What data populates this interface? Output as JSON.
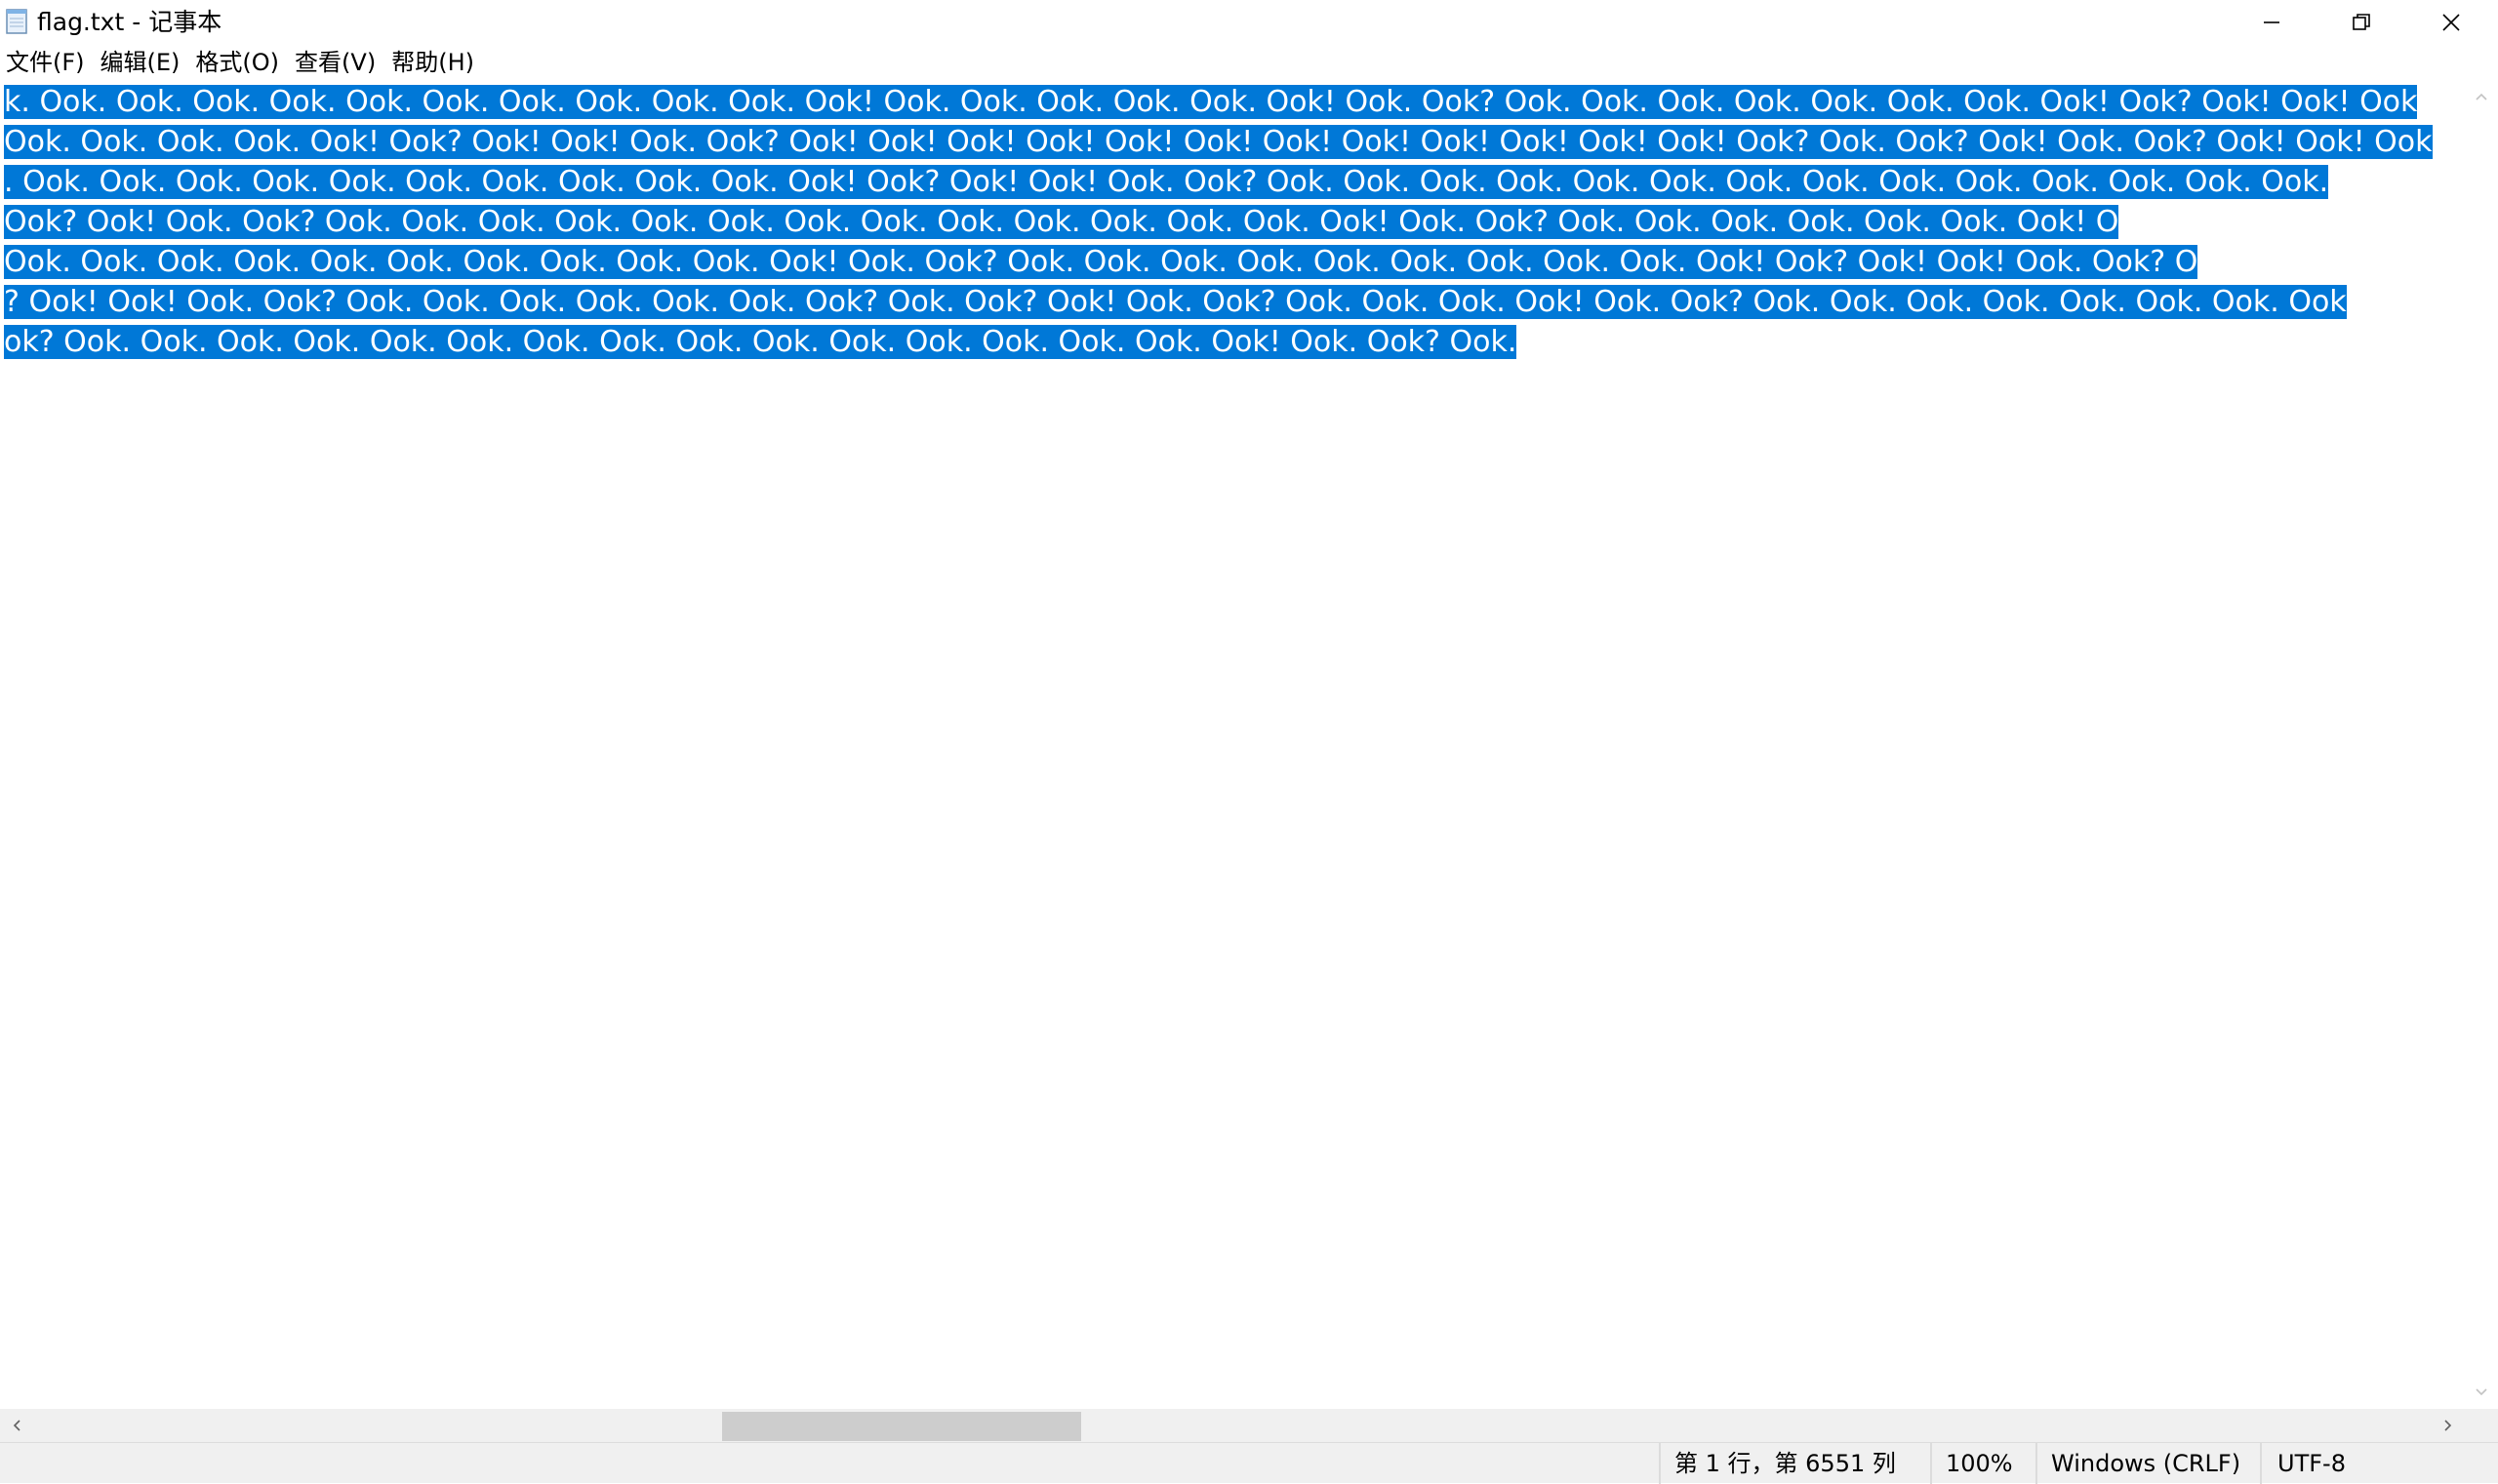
{
  "window": {
    "title": "flag.txt - 记事本"
  },
  "menu": {
    "items": [
      {
        "label": "文件(F)"
      },
      {
        "label": "编辑(E)"
      },
      {
        "label": "格式(O)"
      },
      {
        "label": "查看(V)"
      },
      {
        "label": "帮助(H)"
      }
    ]
  },
  "editor": {
    "lines": [
      "k. Ook. Ook. Ook. Ook. Ook. Ook. Ook. Ook. Ook. Ook. Ook! Ook. Ook. Ook. Ook. Ook. Ook! Ook. Ook? Ook. Ook. Ook. Ook. Ook. Ook. Ook. Ook! Ook? Ook! Ook! Ook",
      "Ook. Ook. Ook. Ook. Ook! Ook? Ook! Ook! Ook. Ook? Ook! Ook! Ook! Ook! Ook! Ook! Ook! Ook! Ook! Ook! Ook! Ook! Ook? Ook. Ook? Ook! Ook. Ook? Ook! Ook! Ook",
      ". Ook. Ook. Ook. Ook. Ook. Ook. Ook. Ook. Ook. Ook. Ook! Ook? Ook! Ook! Ook. Ook? Ook. Ook. Ook. Ook. Ook. Ook. Ook. Ook. Ook. Ook. Ook. Ook. Ook. Ook.",
      "Ook? Ook! Ook. Ook? Ook. Ook. Ook. Ook. Ook. Ook. Ook. Ook. Ook. Ook. Ook. Ook. Ook. Ook! Ook. Ook? Ook. Ook. Ook. Ook. Ook. Ook. Ook! O",
      "Ook. Ook. Ook. Ook. Ook. Ook. Ook. Ook. Ook. Ook. Ook! Ook. Ook? Ook. Ook. Ook. Ook. Ook. Ook. Ook. Ook. Ook. Ook! Ook? Ook! Ook! Ook. Ook? O",
      "? Ook! Ook! Ook. Ook? Ook. Ook. Ook. Ook. Ook. Ook. Ook? Ook. Ook? Ook! Ook. Ook? Ook. Ook. Ook. Ook! Ook. Ook? Ook. Ook. Ook. Ook. Ook. Ook. Ook. Ook",
      "ok? Ook. Ook. Ook. Ook. Ook. Ook. Ook. Ook. Ook. Ook. Ook. Ook. Ook. Ook. Ook. Ook! Ook. Ook? Ook. "
    ]
  },
  "status": {
    "position": "第 1 行，第 6551 列",
    "zoom": "100%",
    "line_ending": "Windows (CRLF)",
    "encoding": "UTF-8"
  },
  "colors": {
    "selection": "#0078d7",
    "selection_text": "#ffffff",
    "statusbar": "#f0f0f0",
    "scroll_thumb": "#cdcdcd"
  }
}
